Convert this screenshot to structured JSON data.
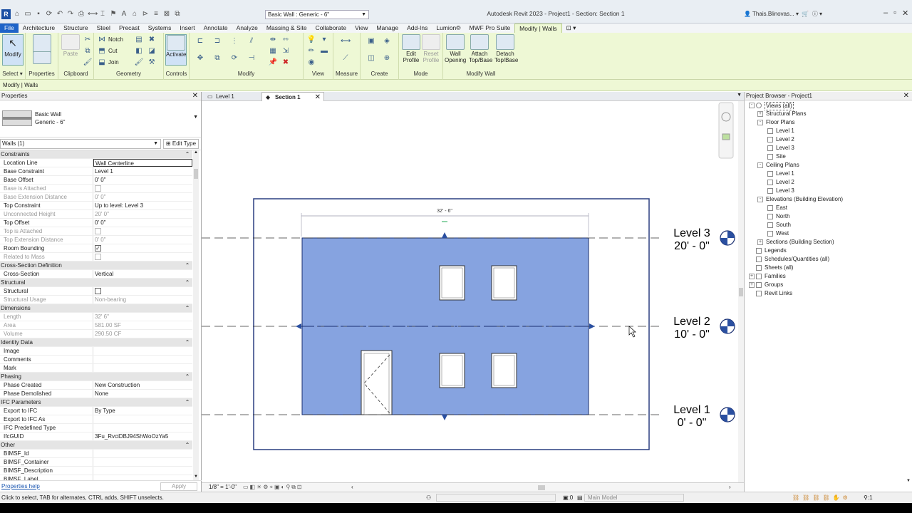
{
  "title_bar": {
    "app_logo": "R",
    "type_selector": "Basic Wall : Generic - 6\"",
    "app_title": "Autodesk Revit 2023 - Project1 - Section: Section 1",
    "user": "Thais.Blinovas..."
  },
  "ribbon_tabs": [
    "File",
    "Architecture",
    "Structure",
    "Steel",
    "Precast",
    "Systems",
    "Insert",
    "Annotate",
    "Analyze",
    "Massing & Site",
    "Collaborate",
    "View",
    "Manage",
    "Add-Ins",
    "Lumion®",
    "MWF Pro Suite",
    "Modify | Walls"
  ],
  "ribbon": {
    "select": {
      "button": "Modify",
      "label": "Select"
    },
    "properties": {
      "label": "Properties"
    },
    "clipboard": {
      "paste": "Paste",
      "label": "Clipboard"
    },
    "geometry": {
      "notch": "Notch",
      "cut": "Cut",
      "join": "Join",
      "label": "Geometry"
    },
    "controls": {
      "activate": "Activate",
      "label": "Controls"
    },
    "modify": {
      "label": "Modify"
    },
    "view": {
      "label": "View"
    },
    "measure": {
      "label": "Measure"
    },
    "create": {
      "label": "Create"
    },
    "mode": {
      "edit_profile": "Edit Profile",
      "reset_profile": "Reset Profile",
      "label": "Mode"
    },
    "modify_wall": {
      "wall_opening": "Wall Opening",
      "attach": "Attach Top/Base",
      "detach": "Detach Top/Base",
      "label": "Modify Wall"
    }
  },
  "context_bar": "Modify | Walls",
  "properties": {
    "header": "Properties",
    "type_name_1": "Basic Wall",
    "type_name_2": "Generic - 6\"",
    "instance_selector": "Walls (1)",
    "edit_type": "Edit Type",
    "rows": [
      {
        "section": "Constraints"
      },
      {
        "k": "Location Line",
        "v": "Wall Centerline",
        "hl": true
      },
      {
        "k": "Base Constraint",
        "v": "Level 1"
      },
      {
        "k": "Base Offset",
        "v": "0'  0\""
      },
      {
        "k": "Base is Attached",
        "cb": false,
        "dis": true
      },
      {
        "k": "Base Extension Distance",
        "v": "0'  0\"",
        "dis": true
      },
      {
        "k": "Top Constraint",
        "v": "Up to level: Level 3"
      },
      {
        "k": "Unconnected Height",
        "v": "20'  0\"",
        "dis": true
      },
      {
        "k": "Top Offset",
        "v": "0'  0\""
      },
      {
        "k": "Top is Attached",
        "cb": false,
        "dis": true
      },
      {
        "k": "Top Extension Distance",
        "v": "0'  0\"",
        "dis": true
      },
      {
        "k": "Room Bounding",
        "cb": true
      },
      {
        "k": "Related to Mass",
        "cb": false,
        "dis": true
      },
      {
        "section": "Cross-Section Definition"
      },
      {
        "k": "Cross-Section",
        "v": "Vertical"
      },
      {
        "section": "Structural"
      },
      {
        "k": "Structural",
        "cb": false
      },
      {
        "k": "Structural Usage",
        "v": "Non-bearing",
        "dis": true
      },
      {
        "section": "Dimensions"
      },
      {
        "k": "Length",
        "v": "32'  6\"",
        "dis": true
      },
      {
        "k": "Area",
        "v": "581.00 SF",
        "dis": true
      },
      {
        "k": "Volume",
        "v": "290.50 CF",
        "dis": true
      },
      {
        "section": "Identity Data"
      },
      {
        "k": "Image",
        "v": ""
      },
      {
        "k": "Comments",
        "v": ""
      },
      {
        "k": "Mark",
        "v": ""
      },
      {
        "section": "Phasing"
      },
      {
        "k": "Phase Created",
        "v": "New Construction"
      },
      {
        "k": "Phase Demolished",
        "v": "None"
      },
      {
        "section": "IFC Parameters"
      },
      {
        "k": "Export to IFC",
        "v": "By Type"
      },
      {
        "k": "Export to IFC As",
        "v": ""
      },
      {
        "k": "IFC Predefined Type",
        "v": ""
      },
      {
        "k": "IfcGUID",
        "v": "3Fu_RvciDBJ94ShWoOzYa5"
      },
      {
        "section": "Other"
      },
      {
        "k": "BIMSF_Id",
        "v": ""
      },
      {
        "k": "BIMSF_Container",
        "v": ""
      },
      {
        "k": "BIMSF_Description",
        "v": ""
      },
      {
        "k": "BIMSF_Label",
        "v": ""
      }
    ],
    "help": "Properties help",
    "apply": "Apply"
  },
  "view_tabs": [
    {
      "label": "Level 1",
      "active": false
    },
    {
      "label": "Section 1",
      "active": true
    }
  ],
  "section_view": {
    "dimension": "32' - 6\"",
    "levels": [
      {
        "name": "Level 3",
        "elev": "20' - 0\""
      },
      {
        "name": "Level 2",
        "elev": "10' - 0\""
      },
      {
        "name": "Level 1",
        "elev": "0' - 0\""
      }
    ],
    "wall_color": "#86a3e0"
  },
  "view_control_bar": {
    "scale": "1/8\" = 1'-0\""
  },
  "project_browser": {
    "header": "Project Browser - Project1",
    "items": [
      {
        "label": "Views (all)",
        "depth": 0,
        "toggle": "-",
        "sel": true
      },
      {
        "label": "Structural Plans",
        "depth": 1,
        "toggle": "+"
      },
      {
        "label": "Floor Plans",
        "depth": 1,
        "toggle": "-"
      },
      {
        "label": "Level 1",
        "depth": 2,
        "view": true
      },
      {
        "label": "Level 2",
        "depth": 2,
        "view": true
      },
      {
        "label": "Level 3",
        "depth": 2,
        "view": true
      },
      {
        "label": "Site",
        "depth": 2,
        "view": true
      },
      {
        "label": "Ceiling Plans",
        "depth": 1,
        "toggle": "-"
      },
      {
        "label": "Level 1",
        "depth": 2,
        "view": true
      },
      {
        "label": "Level 2",
        "depth": 2,
        "view": true
      },
      {
        "label": "Level 3",
        "depth": 2,
        "view": true
      },
      {
        "label": "Elevations (Building Elevation)",
        "depth": 1,
        "toggle": "-"
      },
      {
        "label": "East",
        "depth": 2,
        "view": true
      },
      {
        "label": "North",
        "depth": 2,
        "view": true
      },
      {
        "label": "South",
        "depth": 2,
        "view": true
      },
      {
        "label": "West",
        "depth": 2,
        "view": true
      },
      {
        "label": "Sections (Building Section)",
        "depth": 1,
        "toggle": "+"
      },
      {
        "label": "Legends",
        "depth": 0,
        "icon": true
      },
      {
        "label": "Schedules/Quantities (all)",
        "depth": 0,
        "icon": true
      },
      {
        "label": "Sheets (all)",
        "depth": 0,
        "icon": true
      },
      {
        "label": "Families",
        "depth": 0,
        "toggle": "+",
        "icon": true
      },
      {
        "label": "Groups",
        "depth": 0,
        "toggle": "+",
        "icon": true
      },
      {
        "label": "Revit Links",
        "depth": 0,
        "icon": true
      }
    ]
  },
  "status_bar": {
    "message": "Click to select, TAB for alternates, CTRL adds, SHIFT unselects.",
    "zero": ":0",
    "model": "Main Model"
  }
}
